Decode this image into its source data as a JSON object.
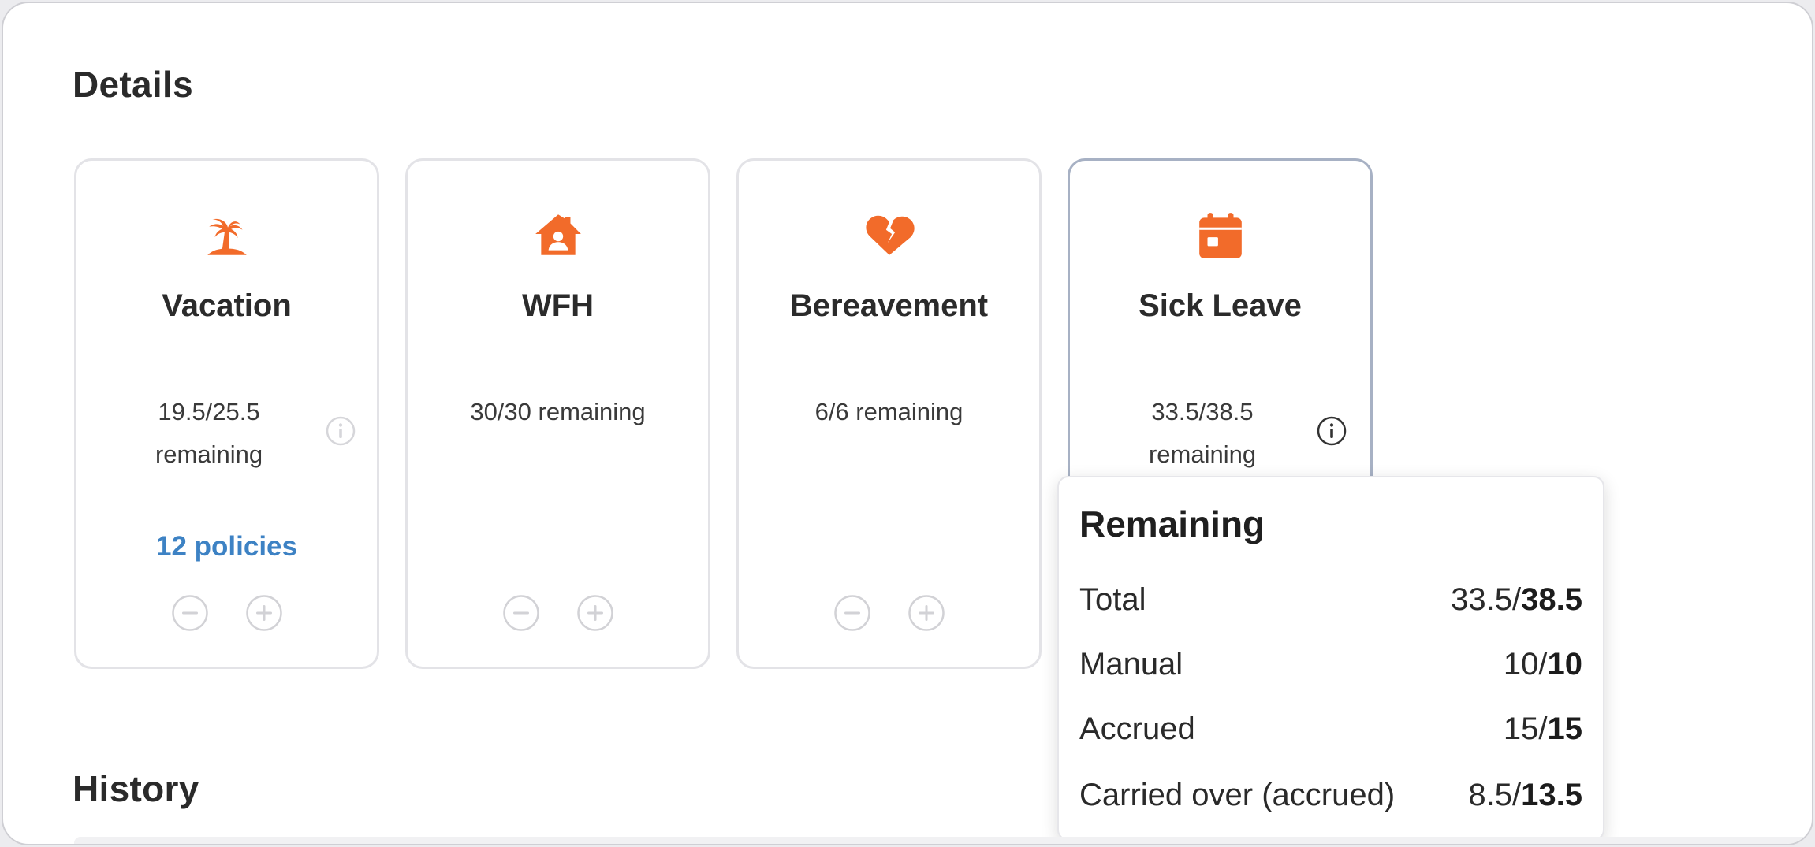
{
  "details": {
    "title": "Details",
    "cards": [
      {
        "icon": "palm-tree-icon",
        "title": "Vacation",
        "remaining": "19.5/25.5 remaining",
        "remaining_line1": "19.5/25.5",
        "remaining_line2": "remaining",
        "has_info": true,
        "policies": "12 policies"
      },
      {
        "icon": "home-user-icon",
        "title": "WFH",
        "remaining": "30/30 remaining",
        "has_info": false
      },
      {
        "icon": "broken-heart-icon",
        "title": "Bereavement",
        "remaining": "6/6 remaining",
        "has_info": false
      },
      {
        "icon": "calendar-icon",
        "title": "Sick Leave",
        "remaining": "33.5/38.5 remaining",
        "remaining_line1": "33.5/38.5",
        "remaining_line2": "remaining",
        "has_info": true
      }
    ]
  },
  "popover": {
    "title": "Remaining",
    "rows": [
      {
        "label": "Total",
        "used": "33.5/",
        "total": "38.5"
      },
      {
        "label": "Manual",
        "used": "10/",
        "total": "10"
      },
      {
        "label": "Accrued",
        "used": "15/",
        "total": "15"
      },
      {
        "label": "Carried over (accrued)",
        "used": "8.5/",
        "total": "13.5"
      }
    ]
  },
  "history": {
    "title": "History"
  },
  "colors": {
    "accent_orange": "#f26b2a",
    "link_blue": "#3d82c4",
    "control_gray": "#cfcfd4"
  }
}
